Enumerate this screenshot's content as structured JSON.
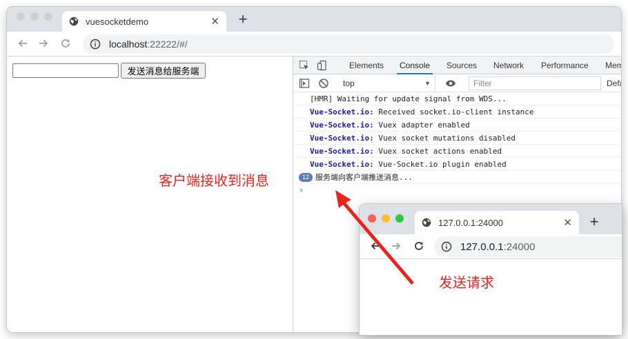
{
  "main_window": {
    "tab_title": "vuesocketdemo",
    "close_glyph": "✕",
    "new_tab_glyph": "+",
    "url_host": "localhost",
    "url_rest": ":22222/#/"
  },
  "page": {
    "input_value": "",
    "send_button_label": "发送消息给服务端"
  },
  "devtools": {
    "tabs": [
      "Elements",
      "Console",
      "Sources",
      "Network",
      "Performance",
      "Mem"
    ],
    "active_tab": "Console",
    "context": "top",
    "filter_placeholder": "Filter",
    "levels_label": "Defa",
    "console_lines": [
      {
        "source": "",
        "message": "[HMR] Waiting for update signal from WDS..."
      },
      {
        "source": "Vue-Socket.io:",
        "message": " Received socket.io-client instance"
      },
      {
        "source": "Vue-Socket.io:",
        "message": " Vuex adapter enabled"
      },
      {
        "source": "Vue-Socket.io:",
        "message": " Vuex socket mutations disabled"
      },
      {
        "source": "Vue-Socket.io:",
        "message": " Vuex socket actions enabled"
      },
      {
        "source": "Vue-Socket.io:",
        "message": " Vue-Socket.io plugin enabled"
      }
    ],
    "grouped_count": "12",
    "grouped_message": "服务端向客户端推送消息...",
    "prompt_glyph": "›"
  },
  "popup_window": {
    "tab_title": "127.0.0.1:24000",
    "close_glyph": "✕",
    "new_tab_glyph": "+",
    "url_host": "127.0.0.1",
    "url_rest": ":24000"
  },
  "annotations": {
    "client_received": "客户端接收到消息",
    "send_request": "发送请求"
  },
  "colors": {
    "annotation_red": "#e8231f",
    "accent_blue": "#1a73e8",
    "socket_source": "#1a1aa6"
  }
}
